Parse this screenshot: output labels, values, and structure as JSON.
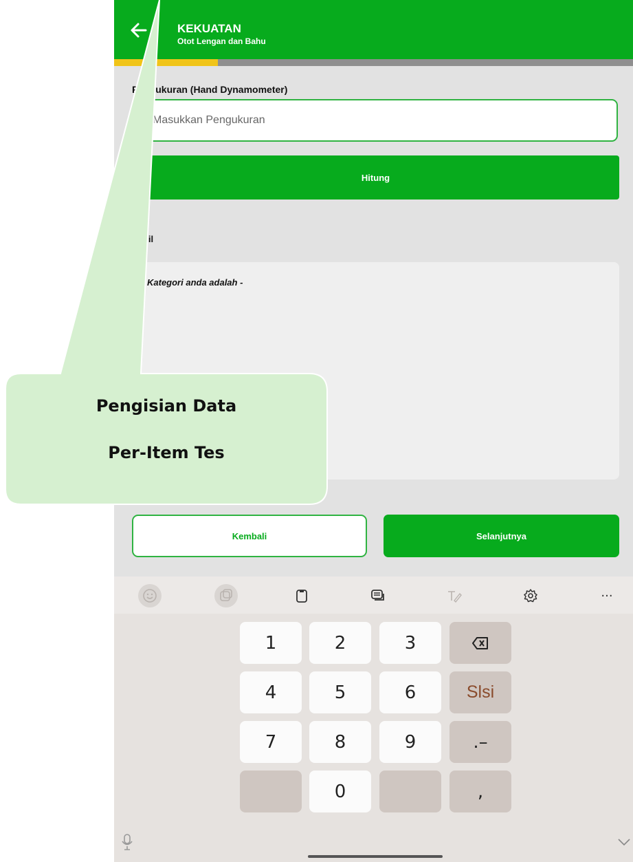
{
  "app_bar": {
    "title": "KEKUATAN",
    "subtitle": "Otot Lengan dan Bahu",
    "back_icon": "arrow-left-icon",
    "background_color": "#07ab1d"
  },
  "progress": {
    "fraction": 0.2,
    "fill_color": "#f0c419",
    "track_color": "#8f8f8f"
  },
  "form": {
    "measurement_label": "Pengukuran (Hand Dynamometer)",
    "measurement_placeholder": "Masukkan Pengukuran",
    "measurement_value": "",
    "hitung_label": "Hitung"
  },
  "result": {
    "label": "Hasil",
    "text": "Kategori anda adalah -"
  },
  "footer_buttons": {
    "back_label": "Kembali",
    "next_label": "Selanjutnya"
  },
  "keyboard": {
    "toolbar_icons": [
      "emoji-icon",
      "sticker-icon",
      "clipboard-icon",
      "keyboard-layout-icon",
      "handwriting-icon",
      "settings-icon",
      "more-icon"
    ],
    "rows": [
      [
        "1",
        "2",
        "3",
        "backspace"
      ],
      [
        "4",
        "5",
        "6",
        "Slsi"
      ],
      [
        "7",
        "8",
        "9",
        ".–"
      ],
      [
        "",
        "0",
        "",
        ","
      ]
    ],
    "more_label": "···"
  },
  "annotation": {
    "title": "Pengisian Data",
    "subtitle": "Per-Item Tes",
    "fill_color": "#d6f0d0"
  }
}
